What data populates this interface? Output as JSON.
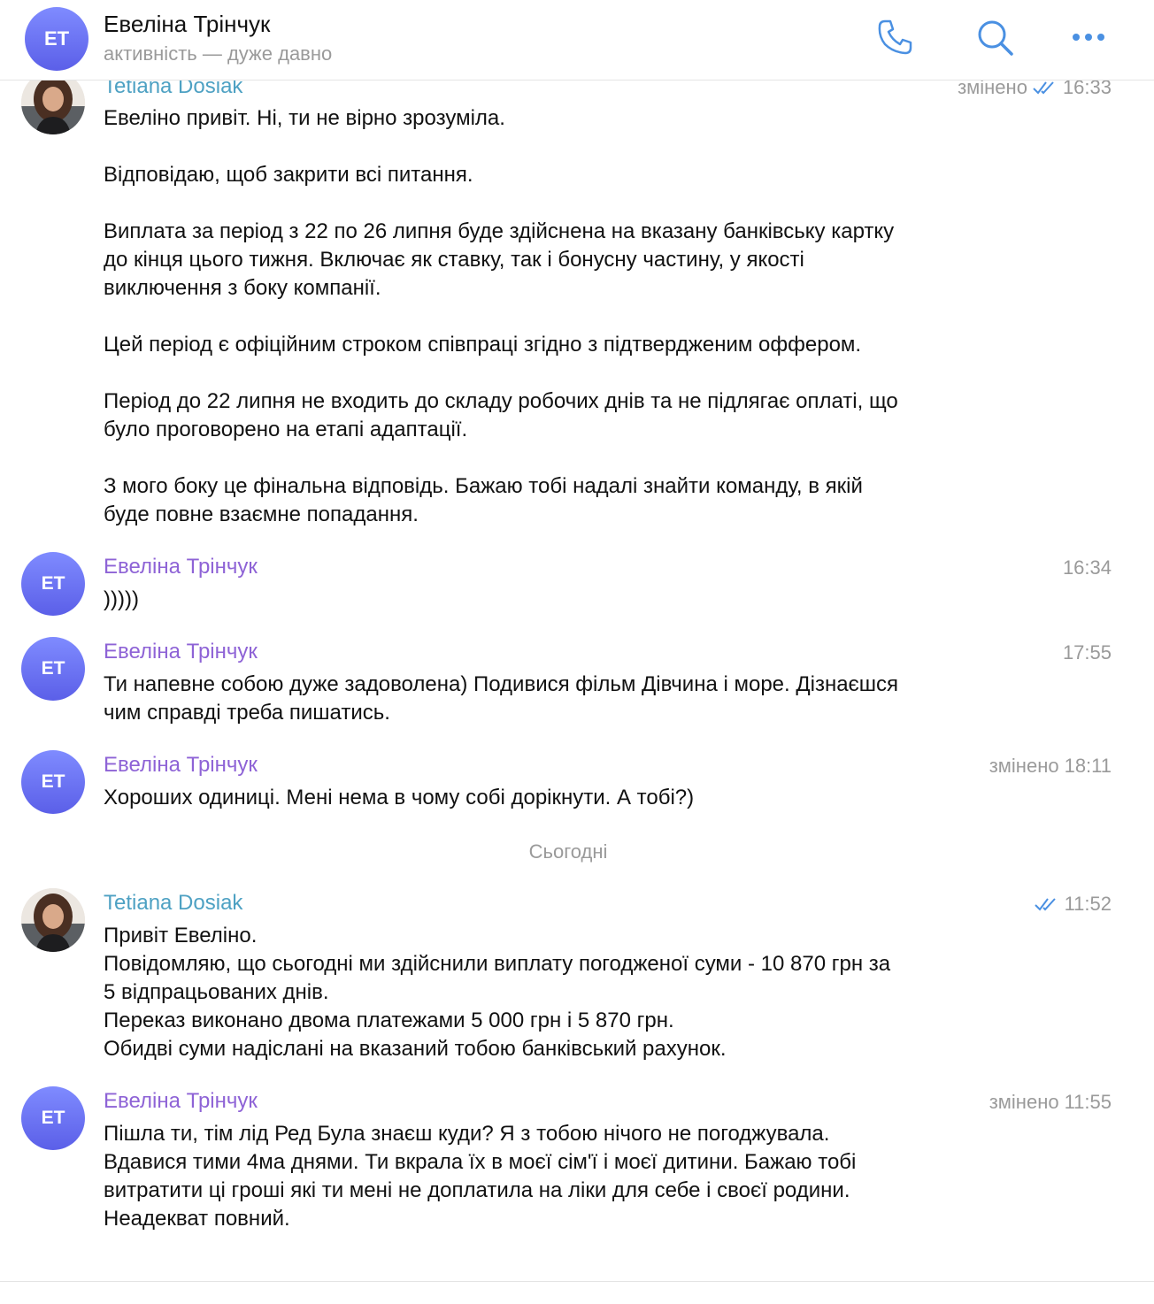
{
  "header": {
    "avatar_initials": "ET",
    "name": "Евеліна Трінчук",
    "status": "активність — дуже давно",
    "icons": [
      "phone-icon",
      "search-icon",
      "more-icon"
    ]
  },
  "colors": {
    "accent": "#4a90e2",
    "avatar_gradient": [
      "#7f8bff",
      "#5b5fe8"
    ],
    "sender_tetiana": "#4ea1c3",
    "sender_evelina": "#8e63d6",
    "meta": "#9a9a9a"
  },
  "messages": [
    {
      "sender": "Tetiana Dosiak",
      "avatar": "photo",
      "meta": "змінено",
      "time": "16:33",
      "read": true,
      "text": "Евеліно привіт. Ні, ти не вірно зрозуміла.\n\nВідповідаю, щоб закрити всі питання.\n\nВиплата за період з 22 по 26 липня буде здійснена на вказану банківську картку\nдо кінця цього тижня. Включає як ставку, так і бонусну частину, у якості\nвиключення з боку компанії.\n\nЦей період є офіційним строком співпраці згідно з підтвердженим оффером.\n\nПеріод до 22 липня не входить до складу робочих днів та не підлягає оплаті, що\nбуло проговорено на етапі адаптації.\n\nЗ мого боку це фінальна відповідь. Бажаю тобі надалі знайти команду, в якій\nбуде повне взаємне попадання."
    },
    {
      "sender": "Евеліна Трінчук",
      "avatar": "ET",
      "meta": "",
      "time": "16:34",
      "text": ")))))"
    },
    {
      "sender": "Евеліна Трінчук",
      "avatar": "ET",
      "meta": "",
      "time": "17:55",
      "text": "Ти напевне собою дуже задоволена) Подивися фільм Дівчина і море. Дізнаєшся\nчим справді треба пишатись."
    },
    {
      "sender": "Евеліна Трінчук",
      "avatar": "ET",
      "meta": "змінено",
      "time": "18:11",
      "text": "Хороших одиниці. Мені нема в чому собі дорікнути. А тобі?)"
    },
    {
      "sender": "Tetiana Dosiak",
      "avatar": "photo",
      "meta": "",
      "time": "11:52",
      "read": true,
      "text": "Привіт Евеліно.\nПовідомляю, що сьогодні ми здійснили виплату погодженої суми - 10 870 грн за\n5 відпрацьованих днів.\nПереказ виконано двома платежами 5 000 грн і 5 870 грн.\nОбидві суми надіслані на вказаний тобою банківський рахунок."
    },
    {
      "sender": "Евеліна Трінчук",
      "avatar": "ET",
      "meta": "змінено",
      "time": "11:55",
      "text": "Пішла ти, тім лід Ред Була знаєш куди? Я з тобою нічого не погоджувала.\nВдавися тими 4ма днями. Ти вкрала їх в моєї сім'ї і моєї дитини. Бажаю тобі\nвитратити ці гроші які ти мені не доплатила на ліки для себе і своєї родини.\nНеадекват повний."
    }
  ],
  "day_separator": "Сьогодні"
}
